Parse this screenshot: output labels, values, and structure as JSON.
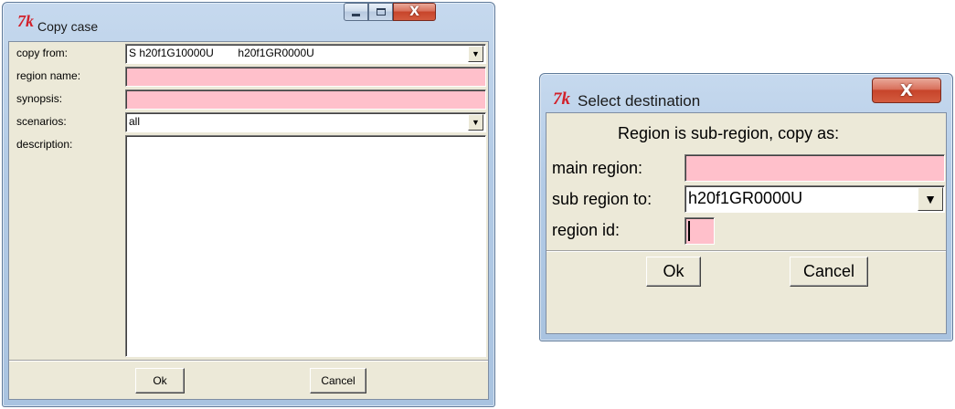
{
  "copy_case": {
    "title": "Copy case",
    "tk_icon": "7k",
    "icons": {
      "minimize": "minimize-icon",
      "maximize": "maximize-icon",
      "close": "close-icon"
    },
    "close_glyph": "X",
    "fields": {
      "copy_from_label": "copy from:",
      "copy_from_value": "S h20f1G10000U        h20f1GR0000U",
      "region_name_label": "region name:",
      "region_name_value": "",
      "synopsis_label": "synopsis:",
      "synopsis_value": "",
      "scenarios_label": "scenarios:",
      "scenarios_value": "all",
      "description_label": "description:",
      "description_value": ""
    },
    "dropdown_glyph": "▼",
    "ok_label": "Ok",
    "cancel_label": "Cancel"
  },
  "select_destination": {
    "title": "Select destination",
    "tk_icon": "7k",
    "close_glyph": "X",
    "heading": "Region is sub-region, copy as:",
    "main_region_label": "main region:",
    "main_region_value": "",
    "sub_region_label": "sub region to:",
    "sub_region_value": "h20f1GR0000U",
    "region_id_label": "region id:",
    "region_id_value": "",
    "dropdown_glyph": "▼",
    "ok_label": "Ok",
    "cancel_label": "Cancel"
  },
  "colors": {
    "required_field": "#ffc0cb",
    "dialog_background": "#ece9d8",
    "close_button": "#c7442a"
  }
}
